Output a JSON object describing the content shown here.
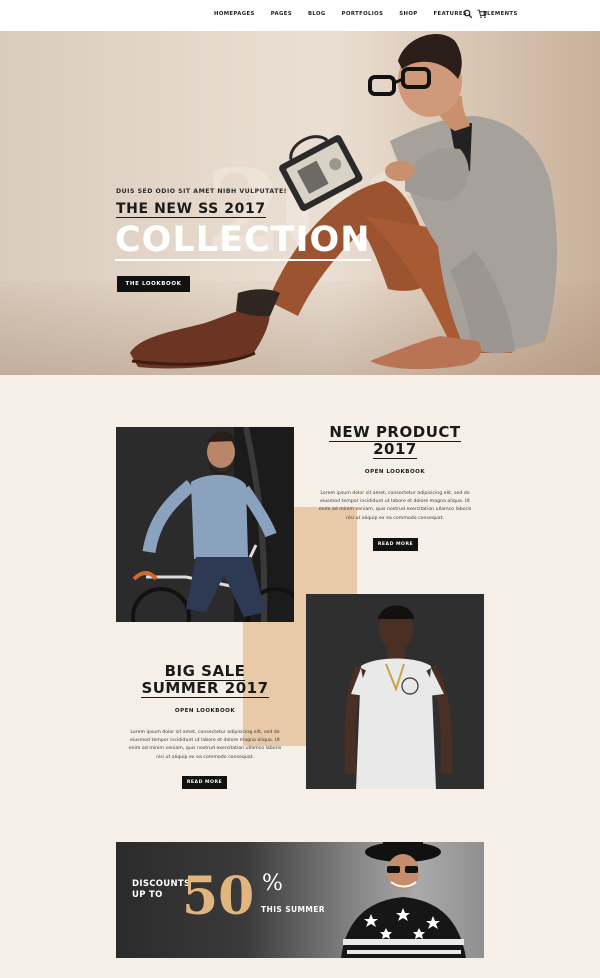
{
  "nav": {
    "links": [
      "HOMEPAGES",
      "PAGES",
      "BLOG",
      "PORTFOLIOS",
      "SHOP",
      "FEATURES",
      "ELEMENTS"
    ],
    "icons": [
      "search-icon",
      "cart-icon"
    ]
  },
  "hero": {
    "eyebrow": "DUIS SED ODIO SIT AMET NIBH VULPUTATE!",
    "subtitle": "THE NEW SS 2017",
    "title": "COLLECTION",
    "watermark": "2017",
    "button": "THE LOOKBOOK"
  },
  "product": {
    "title_line1": "NEW PRODUCT",
    "title_line2": "2017",
    "link": "OPEN LOOKBOOK",
    "body": [
      "Lorem ipsum dolor sit amet, consectetur adipisicing elit, sed do",
      "eiusmod tempor incididunt ut labore et dolore magna aliqua. Ut",
      "enim ad minim veniam, quis nostrud exercitation ullamco laboris",
      "nisi ut aliquip ex ea commodo consequat."
    ],
    "button": "READ MORE"
  },
  "sale": {
    "title_line1": "BIG SALE",
    "title_line2": "SUMMER 2017",
    "link": "OPEN LOOKBOOK",
    "body": [
      "Lorem ipsum dolor sit amet, consectetur adipisicing elit, sed do",
      "eiusmod tempor incididunt ut labore et dolore magna aliqua. Ut",
      "enim ad minim veniam, quis nostrud exercitation ullamco laboris",
      "nisi ut aliquip ex ea commodo consequat."
    ],
    "button": "READ MORE"
  },
  "banner": {
    "label_line1": "DISCOUNTS",
    "label_line2": "UP TO",
    "value": "50",
    "percent": "%",
    "suffix": "THIS SUMMER"
  },
  "colors": {
    "page_bg": "#f6efe8",
    "accent_tan": "#e8c9a8",
    "discount_gold": "#e2b57e",
    "dark": "#111111"
  }
}
